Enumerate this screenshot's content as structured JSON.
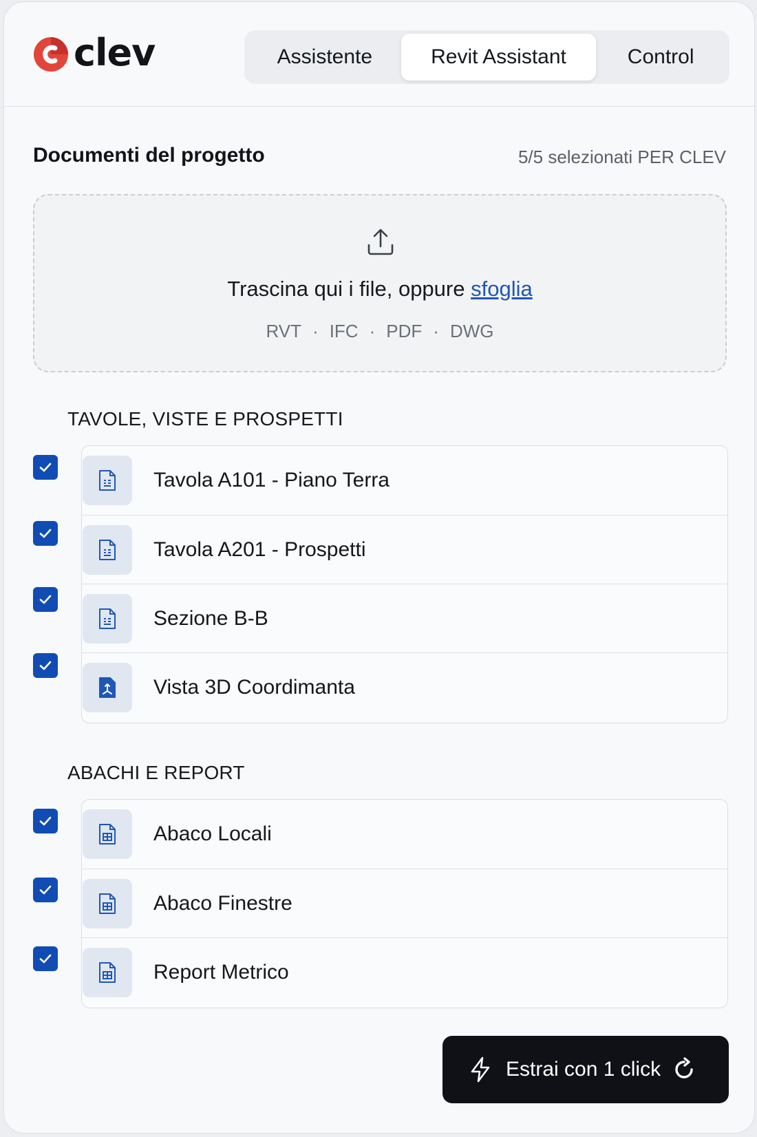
{
  "brand": {
    "name": "clev",
    "accent_color": "#e2453b"
  },
  "tabs": [
    {
      "label": "Assistente",
      "active": false
    },
    {
      "label": "Revit Assistant",
      "active": true
    },
    {
      "label": "Control",
      "active": false
    }
  ],
  "documents": {
    "title": "Documenti del progetto",
    "selection_count": "5/5 selezionati PER CLEV"
  },
  "dropzone": {
    "text": "Trascina qui i file, oppure",
    "link": "sfoglia",
    "formats": [
      "RVT",
      "IFC",
      "PDF",
      "DWG"
    ],
    "icon": "upload-icon"
  },
  "groups": [
    {
      "label": "TAVOLE, VISTE E PROSPETTI",
      "items": [
        {
          "label": "Tavola A101 - Piano Terra",
          "checked": true,
          "icon": "sheet-file-icon"
        },
        {
          "label": "Tavola A201 - Prospetti",
          "checked": true,
          "icon": "sheet-file-icon"
        },
        {
          "label": "Sezione B-B",
          "checked": true,
          "icon": "sheet-file-icon"
        },
        {
          "label": "Vista 3D Coordimanta",
          "checked": true,
          "icon": "model-file-icon"
        }
      ]
    },
    {
      "label": "ABACHI E REPORT",
      "items": [
        {
          "label": "Abaco Locali",
          "checked": true,
          "icon": "schedule-file-icon"
        },
        {
          "label": "Abaco Finestre",
          "checked": true,
          "icon": "schedule-file-icon"
        },
        {
          "label": "Report Metrico",
          "checked": true,
          "icon": "schedule-file-icon"
        }
      ]
    }
  ],
  "action": {
    "label": "Estrai con 1 click",
    "icon": "lightning-icon"
  },
  "colors": {
    "check": "#114cb5",
    "link": "#1f56b8",
    "button": "#0f1116"
  }
}
